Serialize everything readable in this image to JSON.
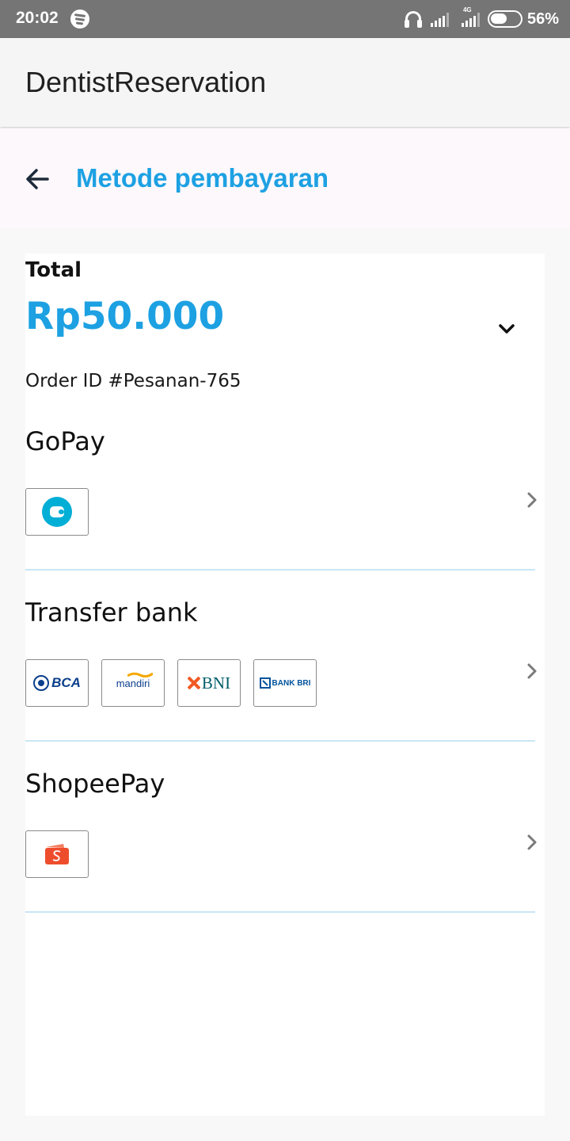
{
  "status_bar": {
    "time": "20:02",
    "network": "4G",
    "battery": "56%",
    "battery_level": 0.56,
    "icons": [
      "spotify-icon",
      "headphones-icon",
      "signal-icon",
      "signal-4g-icon",
      "battery-icon"
    ]
  },
  "app_bar": {
    "title": "DentistReservation"
  },
  "header": {
    "back_icon": "arrow-left-icon",
    "title": "Metode pembayaran"
  },
  "summary": {
    "total_label": "Total",
    "total_amount": "Rp50.000",
    "order_id": "Order ID #Pesanan-765",
    "toggle_icon": "chevron-down-icon"
  },
  "payment_methods": [
    {
      "name": "GoPay",
      "logos": [
        "gopay-logo"
      ]
    },
    {
      "name": "Transfer bank",
      "logos": [
        "BCA",
        "mandiri",
        "BNI",
        "BANK BRI"
      ]
    },
    {
      "name": "ShopeePay",
      "logos": [
        "shopeepay-logo"
      ]
    }
  ],
  "colors": {
    "accent": "#1da1e2",
    "status_bar": "#757575",
    "divider": "#c9e6f5",
    "gopay": "#00aed6",
    "shopee": "#ee4d2d"
  }
}
